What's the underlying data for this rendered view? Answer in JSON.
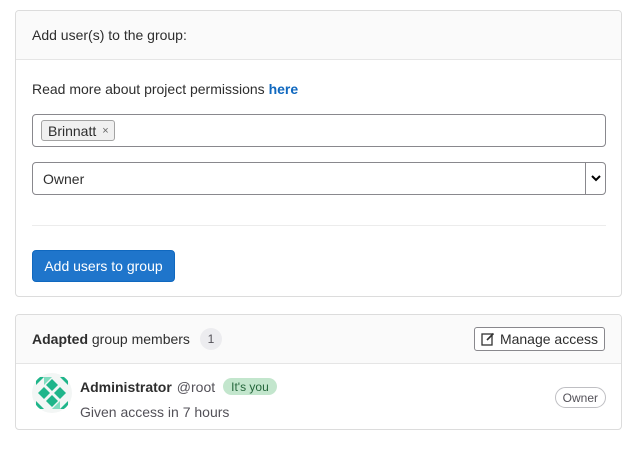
{
  "add_panel": {
    "title": "Add user(s) to the group:",
    "permissions_text": "Read more about project permissions ",
    "permissions_link": "here",
    "selected_user": "Brinnatt",
    "remove_token_glyph": "×",
    "role_value": "Owner",
    "submit_label": "Add users to group"
  },
  "members_panel": {
    "title_bold": "Adapted",
    "title_rest": " group members",
    "count": "1",
    "manage_label": "Manage access",
    "members": [
      {
        "name": "Administrator",
        "handle": "@root",
        "badge": "It's you",
        "access": "Given access in 7 hours",
        "role": "Owner"
      }
    ]
  },
  "colors": {
    "primary": "#1f75cb",
    "link": "#1068bf",
    "you_badge_bg": "#c3e6cd",
    "avatar_green": "#1fb58a"
  },
  "icons": {
    "remove": "close-icon",
    "select": "chevron-down-icon",
    "manage": "edit-icon",
    "avatar": "identicon-avatar"
  }
}
